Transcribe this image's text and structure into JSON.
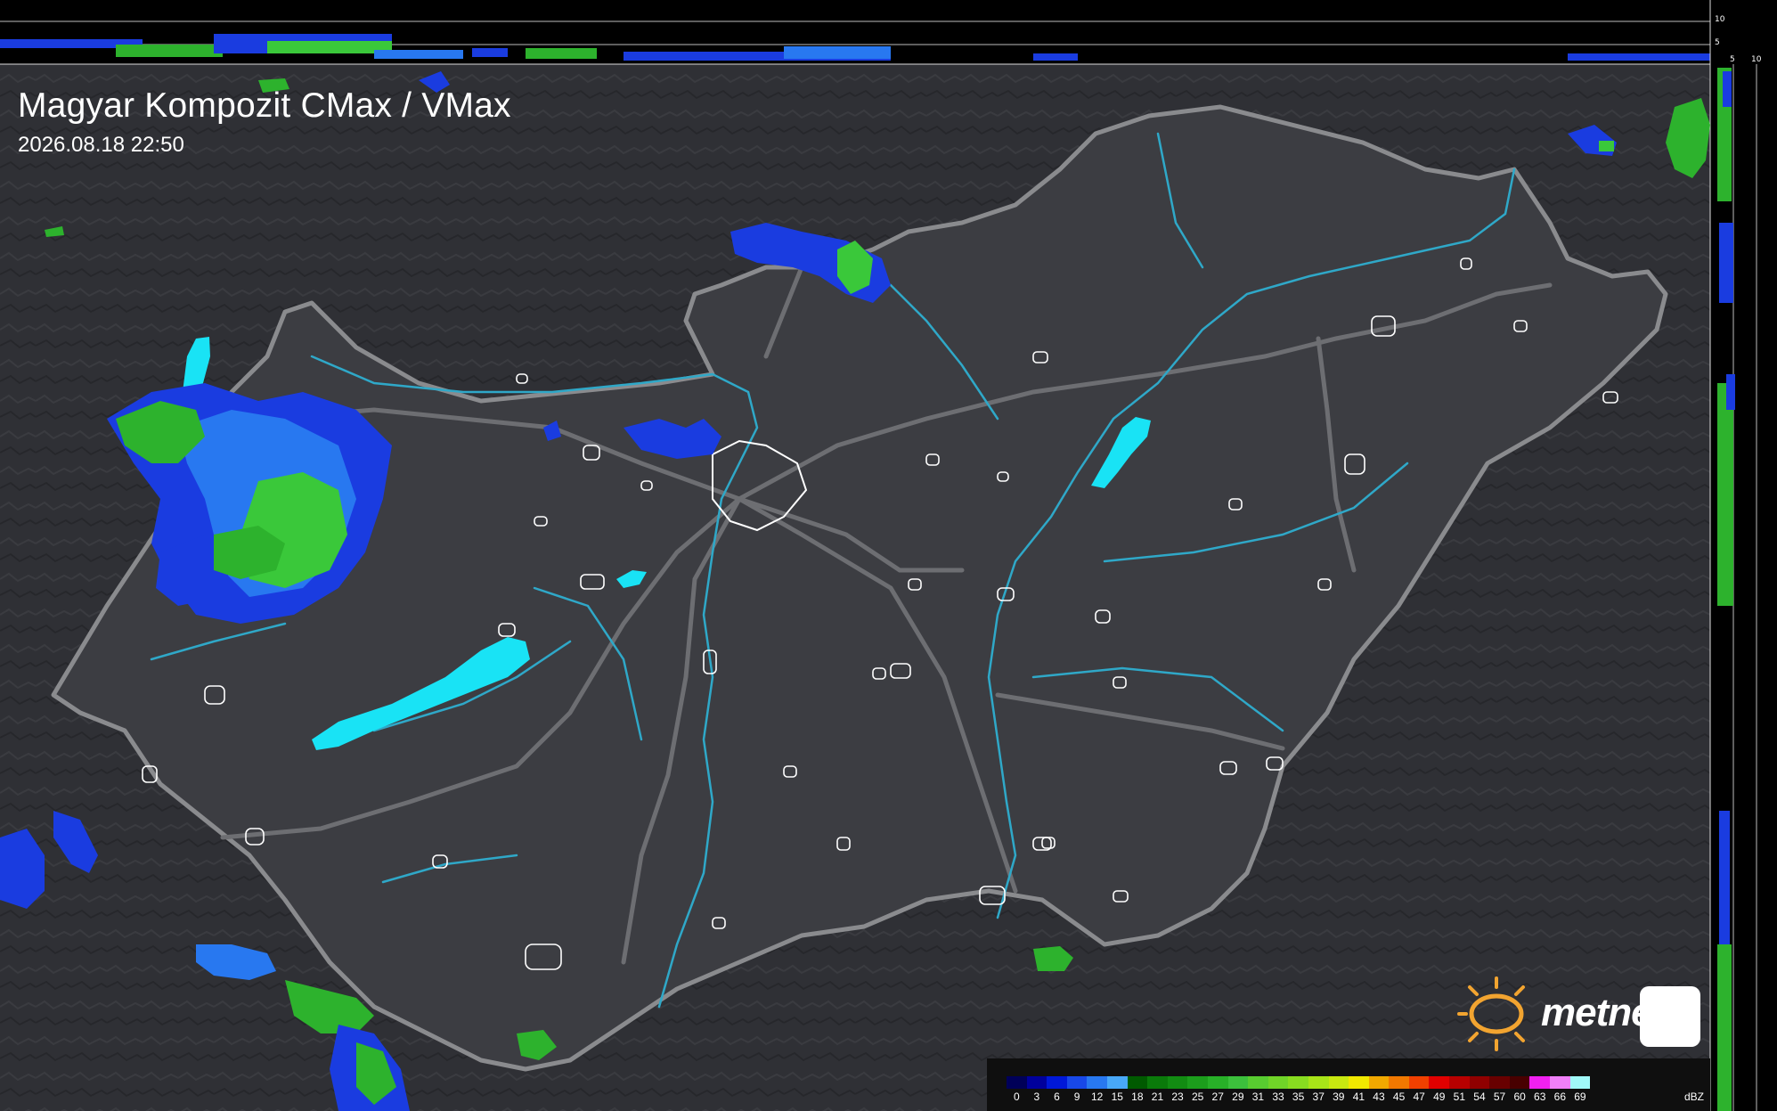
{
  "map": {
    "title": "Magyar Kompozit CMax / VMax",
    "timestamp": "2026.08.18 22:50",
    "brand": "metnet"
  },
  "colors": {
    "background": "#2f3035",
    "country_fill": "#3c3d42",
    "border": "#8a8b8e",
    "river": "#2fa8c8",
    "lake": "#19e3f5",
    "city_outline": "#ffffff",
    "logo_sun": "#f2a430",
    "logo_badge_swirl": "#1fb3b8"
  },
  "side_axes": {
    "top_profile_ticks": [
      "10",
      "5"
    ],
    "right_profile_ticks": [
      "5",
      "10"
    ]
  },
  "legend": {
    "unit": "dBZ",
    "values": [
      "0",
      "3",
      "6",
      "9",
      "12",
      "15",
      "18",
      "21",
      "23",
      "25",
      "27",
      "29",
      "31",
      "33",
      "35",
      "37",
      "39",
      "41",
      "43",
      "45",
      "47",
      "49",
      "51",
      "54",
      "57",
      "60",
      "63",
      "66",
      "69"
    ],
    "colors": [
      "#000058",
      "#00009c",
      "#0018d8",
      "#1848e8",
      "#2878f0",
      "#48a8f8",
      "#005a00",
      "#0a7a0a",
      "#128c12",
      "#1c9e1c",
      "#28b028",
      "#3cc03c",
      "#58cc30",
      "#70d428",
      "#88dc20",
      "#a8e418",
      "#c8e810",
      "#f0e800",
      "#f0a800",
      "#f07800",
      "#f04000",
      "#e00000",
      "#b80000",
      "#900000",
      "#680000",
      "#480000",
      "#f020f0",
      "#f080f8",
      "#a0f8f8"
    ]
  }
}
